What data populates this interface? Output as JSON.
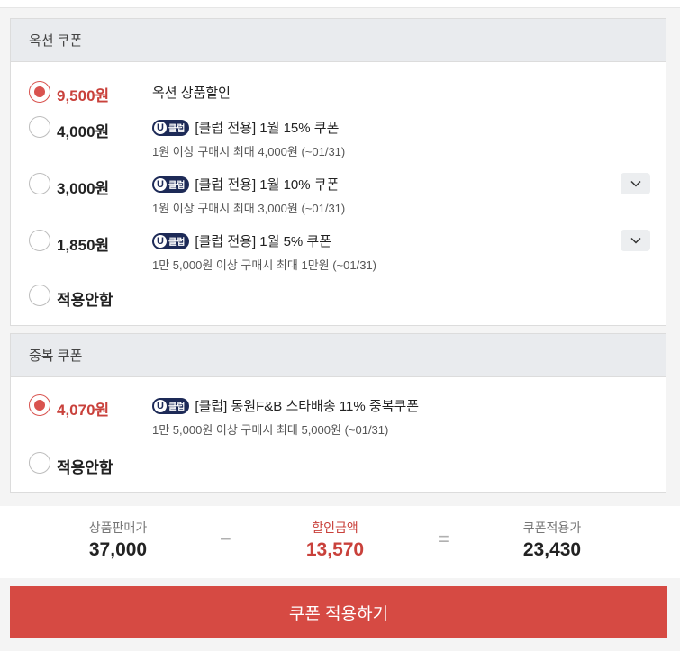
{
  "option_coupons": {
    "title": "옥션 쿠폰",
    "items": [
      {
        "amount": "9,500원",
        "desc": "옥션 상품할인",
        "sub": "",
        "checked": true,
        "club": false
      },
      {
        "amount": "4,000원",
        "desc": "[클럽 전용] 1월 15% 쿠폰",
        "sub": "1원 이상 구매시 최대 4,000원 (~01/31)",
        "checked": false,
        "club": true
      },
      {
        "amount": "3,000원",
        "desc": "[클럽 전용] 1월 10% 쿠폰",
        "sub": "1원 이상 구매시 최대 3,000원 (~01/31)",
        "checked": false,
        "club": true
      },
      {
        "amount": "1,850원",
        "desc": "[클럽 전용] 1월 5% 쿠폰",
        "sub": "1만 5,000원 이상 구매시 최대 1만원 (~01/31)",
        "checked": false,
        "club": true
      },
      {
        "amount": "적용안함",
        "checked": false
      }
    ]
  },
  "duplicate_coupons": {
    "title": "중복 쿠폰",
    "items": [
      {
        "amount": "4,070원",
        "desc": "[클럽] 동원F&B 스타배송 11% 중복쿠폰",
        "sub": "1만 5,000원 이상 구매시 최대 5,000원 (~01/31)",
        "checked": true,
        "club": true
      },
      {
        "amount": "적용안함",
        "checked": false
      }
    ]
  },
  "club_badge": {
    "u": "U",
    "text": "클럽"
  },
  "summary": {
    "price_label": "상품판매가",
    "price_value": "37,000",
    "minus": "−",
    "discount_label": "할인금액",
    "discount_value": "13,570",
    "equals": "=",
    "final_label": "쿠폰적용가",
    "final_value": "23,430"
  },
  "apply_button": "쿠폰 적용하기",
  "colors": {
    "accent": "#d64a43",
    "badge": "#1d2a57"
  }
}
